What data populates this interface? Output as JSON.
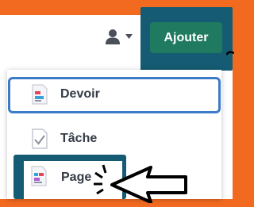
{
  "header": {
    "user_menu_icon": "user-icon",
    "dropdown_icon": "caret-down-icon",
    "add_button_label": "Ajouter"
  },
  "menu": {
    "items": [
      {
        "label": "Devoir",
        "icon": "assignment-icon",
        "highlighted": true
      },
      {
        "label": "Tâche",
        "icon": "task-check-icon",
        "highlighted": false
      },
      {
        "label": "Page",
        "icon": "page-icon",
        "highlighted": true
      }
    ]
  },
  "annotations": {
    "pointer_icon": "click-pointer-arrow-icon",
    "highlight_color": "#145b73",
    "outline_color": "#3b7bc8"
  },
  "colors": {
    "background": "#f26a1f",
    "button": "#1f7a5f",
    "text": "#333a45"
  }
}
